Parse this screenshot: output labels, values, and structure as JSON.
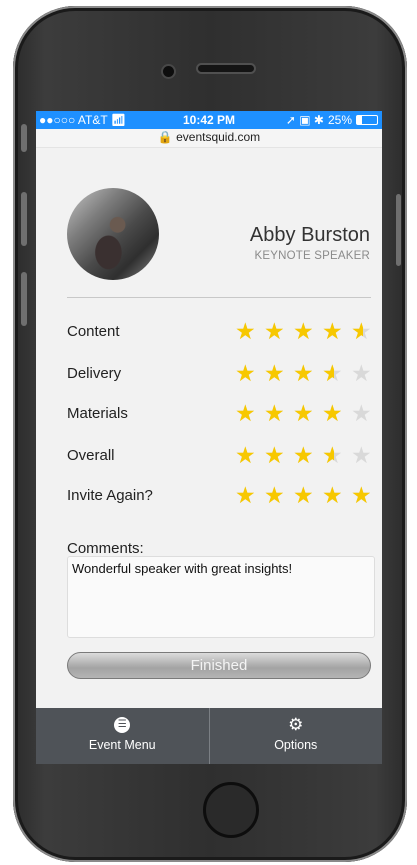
{
  "status_bar": {
    "carrier": "●●○○○ AT&T",
    "wifi_icon": "wifi-icon",
    "time": "10:42 PM",
    "right_icons": "➚ ▣ ✱",
    "battery_text": "25%",
    "battery_level": 0.25
  },
  "browser": {
    "url": "🔒 eventsquid.com"
  },
  "speaker": {
    "name": "Abby Burston",
    "role": "KEYNOTE SPEAKER"
  },
  "ratings": [
    {
      "label": "Content",
      "stars": 4.5
    },
    {
      "label": "Delivery",
      "stars": 3.5
    },
    {
      "label": "Materials",
      "stars": 4
    },
    {
      "label": "Overall",
      "stars": 3.5
    },
    {
      "label": "Invite Again?",
      "stars": 5
    }
  ],
  "comments": {
    "label": "Comments:",
    "value": "Wonderful speaker with great insights!"
  },
  "finished_label": "Finished",
  "bottom_nav": [
    {
      "label": "Event Menu",
      "icon": "list-icon"
    },
    {
      "label": "Options",
      "icon": "gear-icon"
    }
  ],
  "colors": {
    "status_bar": "#1e90ff",
    "star_filled": "#f7c800",
    "star_empty": "#d9d9d9",
    "nav_bar": "#4f5358"
  }
}
